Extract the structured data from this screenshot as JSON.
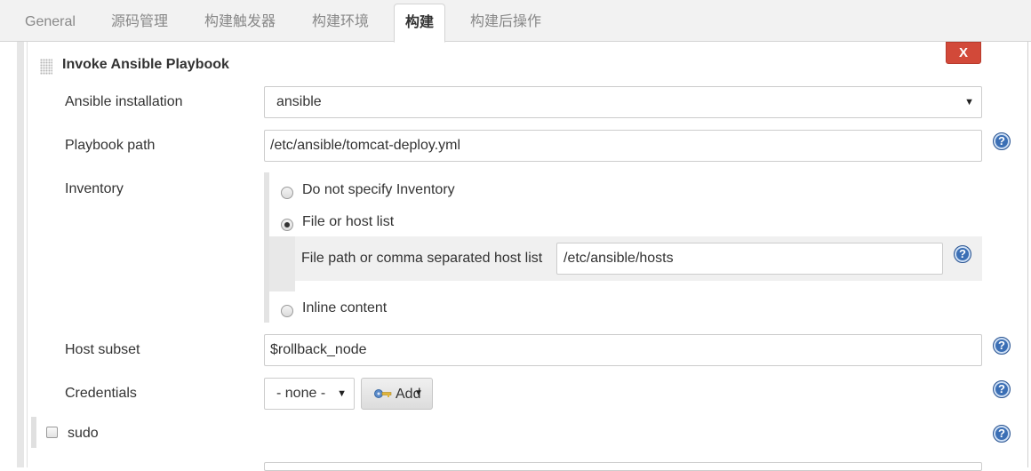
{
  "tabs": [
    {
      "label": "General"
    },
    {
      "label": "源码管理"
    },
    {
      "label": "构建触发器"
    },
    {
      "label": "构建环境"
    },
    {
      "label": "构建",
      "active": true
    },
    {
      "label": "构建后操作"
    }
  ],
  "section": {
    "title": "Invoke Ansible Playbook",
    "delete_label": "X"
  },
  "fields": {
    "ansible_installation": {
      "label": "Ansible installation",
      "value": "ansible"
    },
    "playbook_path": {
      "label": "Playbook path",
      "value": "/etc/ansible/tomcat-deploy.yml"
    },
    "inventory": {
      "label": "Inventory",
      "options": [
        {
          "label": "Do not specify Inventory",
          "checked": false
        },
        {
          "label": "File or host list",
          "checked": true
        },
        {
          "label": "Inline content",
          "checked": false
        }
      ],
      "file_path_label": "File path or comma separated host list",
      "file_path_value": "/etc/ansible/hosts"
    },
    "host_subset": {
      "label": "Host subset",
      "value": "$rollback_node"
    },
    "credentials": {
      "label": "Credentials",
      "value": "- none -",
      "add_label": "Add"
    },
    "sudo": {
      "label": "sudo",
      "checked": false
    }
  },
  "icons": {
    "help": "help-icon",
    "key": "key-icon",
    "dropdown": "chevron-down-icon",
    "grip": "drag-handle-icon"
  },
  "colors": {
    "delete_button": "#d24939",
    "help_icon": "#3b6fb5",
    "active_tab_text": "#333333",
    "inactive_tab_text": "#888888"
  }
}
